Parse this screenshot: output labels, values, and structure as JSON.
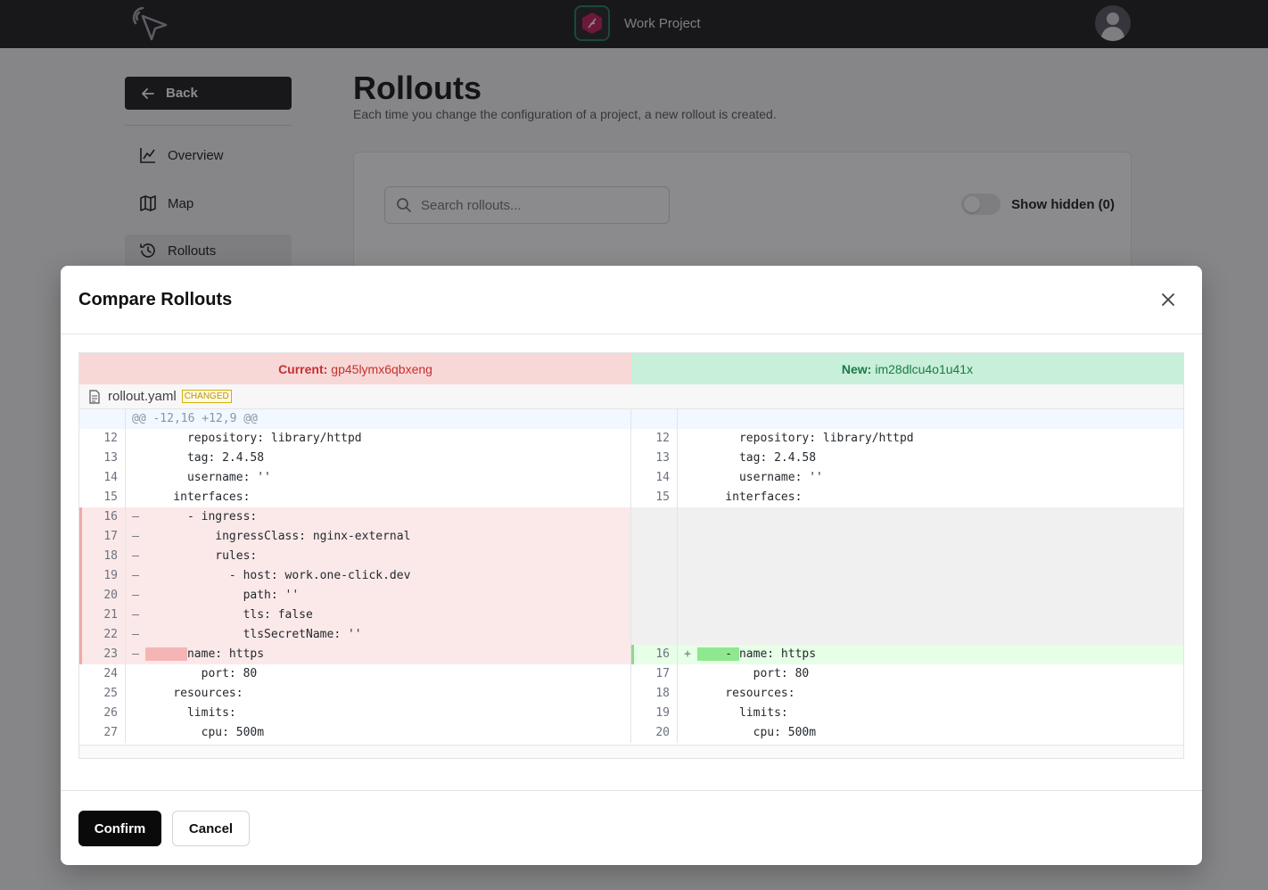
{
  "header": {
    "project_name": "Work Project",
    "logo_icon": "cursor-click-icon",
    "project_icon": "feather-icon",
    "avatar": "user-avatar"
  },
  "sidebar": {
    "back_label": "Back",
    "items": [
      {
        "label": "Overview",
        "icon": "chart-line-icon"
      },
      {
        "label": "Map",
        "icon": "map-icon"
      },
      {
        "label": "Rollouts",
        "icon": "history-icon",
        "active": true
      }
    ]
  },
  "main": {
    "title": "Rollouts",
    "description": "Each time you change the configuration of a project, a new rollout is created.",
    "search_placeholder": "Search rollouts...",
    "show_hidden_label": "Show hidden (0)"
  },
  "modal": {
    "title": "Compare Rollouts",
    "current_label": "Current:",
    "current_id": "gp45lymx6qbxeng",
    "new_label": "New:",
    "new_id": "im28dlcu4o1u41x",
    "file_name": "rollout.yaml",
    "file_badge": "CHANGED",
    "hunk_header": "@@ -12,16 +12,9 @@",
    "rows": [
      {
        "l": {
          "n": "12",
          "m": "",
          "t": "      repository: library/httpd"
        },
        "r": {
          "n": "12",
          "m": "",
          "t": "      repository: library/httpd"
        }
      },
      {
        "l": {
          "n": "13",
          "m": "",
          "t": "      tag: 2.4.58"
        },
        "r": {
          "n": "13",
          "m": "",
          "t": "      tag: 2.4.58"
        }
      },
      {
        "l": {
          "n": "14",
          "m": "",
          "t": "      username: ''"
        },
        "r": {
          "n": "14",
          "m": "",
          "t": "      username: ''"
        }
      },
      {
        "l": {
          "n": "15",
          "m": "",
          "t": "    interfaces:"
        },
        "r": {
          "n": "15",
          "m": "",
          "t": "    interfaces:"
        }
      },
      {
        "type": "del",
        "l": {
          "n": "16",
          "m": "–",
          "t": "      - ingress:"
        }
      },
      {
        "type": "del",
        "l": {
          "n": "17",
          "m": "–",
          "t": "          ingressClass: nginx-external"
        }
      },
      {
        "type": "del",
        "l": {
          "n": "18",
          "m": "–",
          "t": "          rules:"
        }
      },
      {
        "type": "del",
        "l": {
          "n": "19",
          "m": "–",
          "t": "            - host: work.one-click.dev"
        }
      },
      {
        "type": "del",
        "l": {
          "n": "20",
          "m": "–",
          "t": "              path: ''"
        }
      },
      {
        "type": "del",
        "l": {
          "n": "21",
          "m": "–",
          "t": "              tls: false"
        }
      },
      {
        "type": "del",
        "l": {
          "n": "22",
          "m": "–",
          "t": "              tlsSecretName: ''"
        }
      },
      {
        "type": "change",
        "l": {
          "n": "23",
          "m": "–",
          "pre": "",
          "hl": "      ",
          "t": "name: https"
        },
        "r": {
          "n": "16",
          "m": "+",
          "pre": "",
          "hl": "    - ",
          "t": "name: https"
        }
      },
      {
        "l": {
          "n": "24",
          "m": "",
          "t": "        port: 80"
        },
        "r": {
          "n": "17",
          "m": "",
          "t": "        port: 80"
        }
      },
      {
        "l": {
          "n": "25",
          "m": "",
          "t": "    resources:"
        },
        "r": {
          "n": "18",
          "m": "",
          "t": "    resources:"
        }
      },
      {
        "l": {
          "n": "26",
          "m": "",
          "t": "      limits:"
        },
        "r": {
          "n": "19",
          "m": "",
          "t": "      limits:"
        }
      },
      {
        "l": {
          "n": "27",
          "m": "",
          "t": "        cpu: 500m"
        },
        "r": {
          "n": "20",
          "m": "",
          "t": "        cpu: 500m"
        }
      }
    ],
    "confirm_label": "Confirm",
    "cancel_label": "Cancel"
  }
}
